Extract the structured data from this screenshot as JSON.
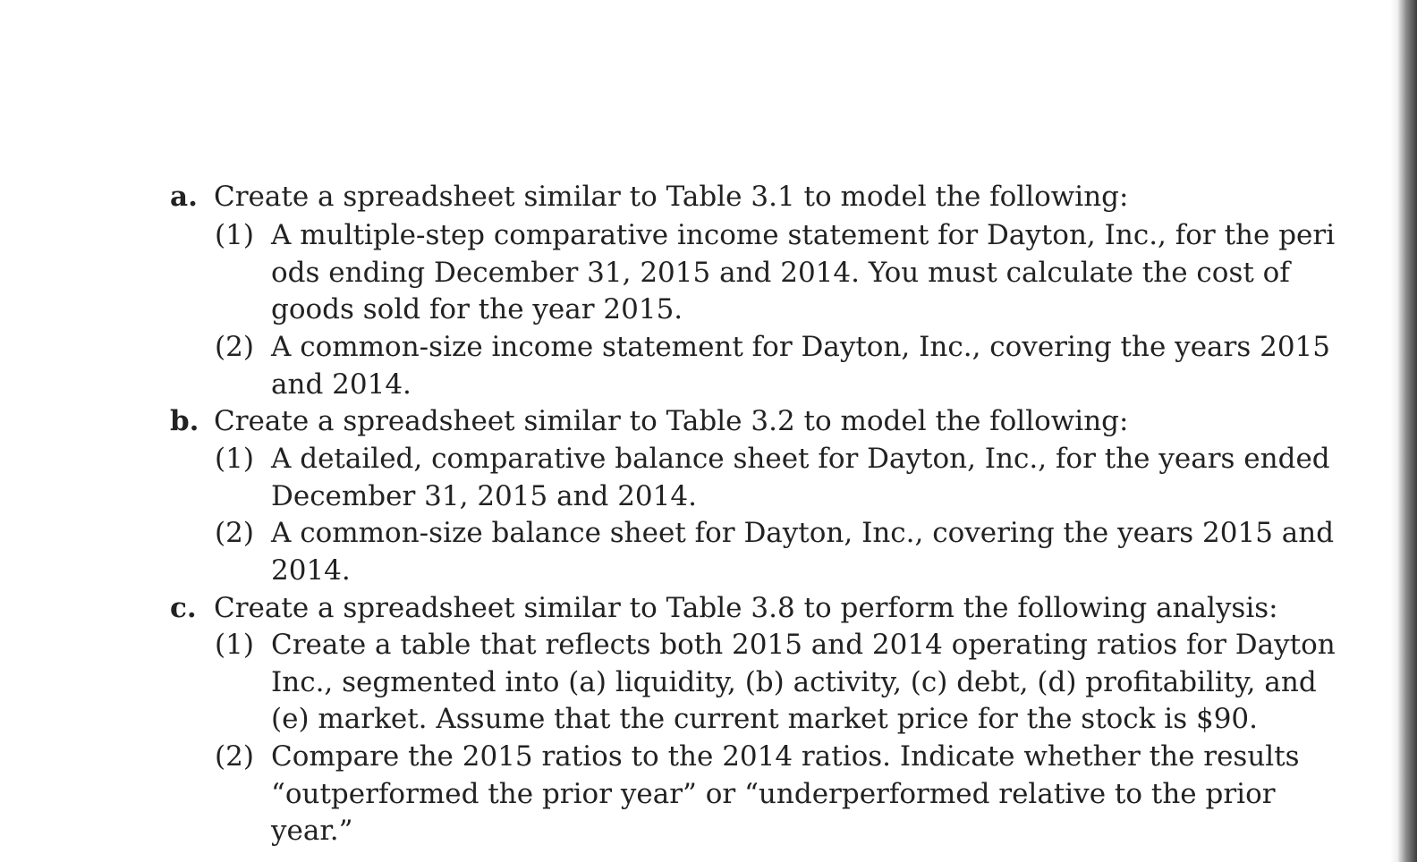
{
  "items": [
    {
      "letter": "a.",
      "heading": "Create a spreadsheet similar to Table 3.1 to model the following:",
      "subitems": [
        {
          "number": "(1)",
          "lines": [
            "A multiple-step comparative income statement for Dayton, Inc., for the peri",
            "ods ending December 31, 2015 and 2014. You must calculate the cost of",
            "goods sold for the year 2015."
          ]
        },
        {
          "number": "(2)",
          "lines": [
            "A common-size income statement for Dayton, Inc., covering the years 2015",
            "and 2014."
          ]
        }
      ]
    },
    {
      "letter": "b.",
      "heading": "Create a spreadsheet similar to Table 3.2 to model the following:",
      "subitems": [
        {
          "number": "(1)",
          "lines": [
            "A detailed, comparative balance sheet for Dayton, Inc., for the years ended",
            "December 31, 2015 and 2014."
          ]
        },
        {
          "number": "(2)",
          "lines": [
            "A common-size balance sheet for Dayton, Inc., covering the years 2015 and",
            "2014."
          ]
        }
      ]
    },
    {
      "letter": "c.",
      "heading": "Create a spreadsheet similar to Table 3.8 to perform the following analysis:",
      "subitems": [
        {
          "number": "(1)",
          "lines": [
            "Create a table that reflects both 2015 and 2014 operating ratios for Dayton",
            "Inc., segmented into (a) liquidity, (b) activity, (c) debt, (d) profitability, and",
            "(e) market. Assume that the current market price for the stock is $90."
          ]
        },
        {
          "number": "(2)",
          "lines": [
            "Compare the 2015 ratios to the 2014 ratios. Indicate whether the results",
            "“outperformed the prior year” or “underperformed relative to the prior",
            "year.”"
          ]
        }
      ]
    }
  ]
}
